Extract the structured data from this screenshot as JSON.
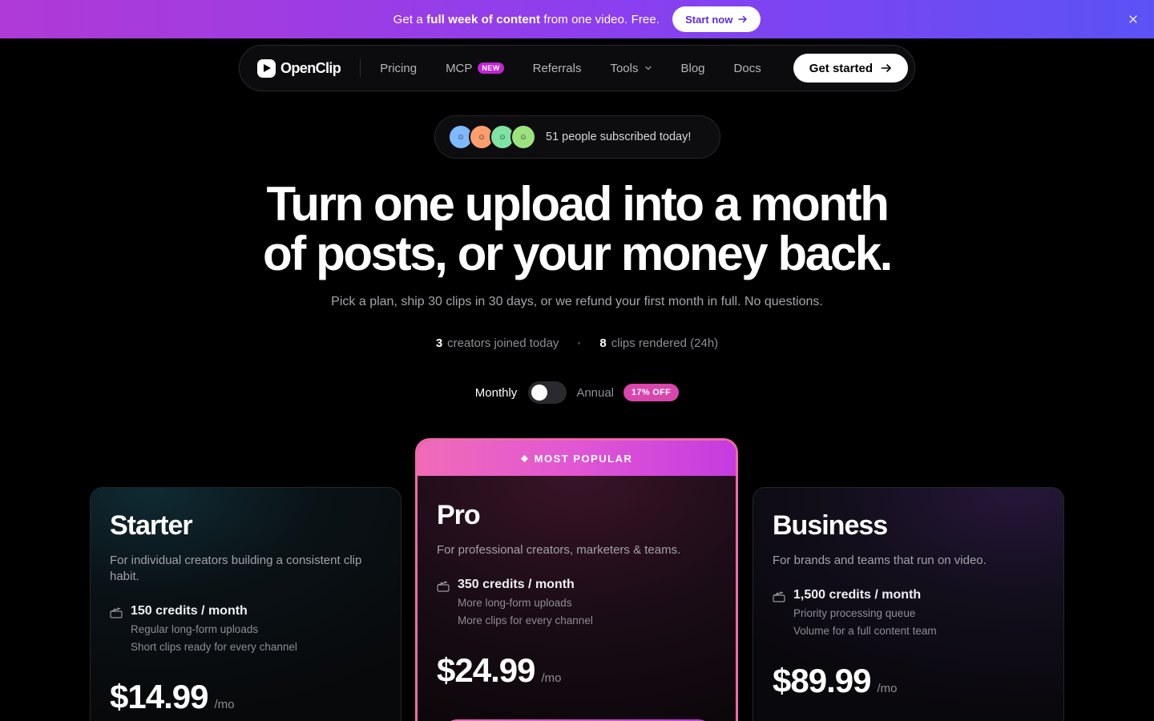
{
  "announcement": {
    "prefix": "Get a ",
    "bold": "full week of content",
    "suffix": " from one video. Free.",
    "button_label": "Start now",
    "button_icon": "arrow-right-icon",
    "close_icon": "close-icon"
  },
  "nav": {
    "logo_text": "OpenClip",
    "links": [
      {
        "label": "Pricing"
      },
      {
        "label": "MCP",
        "badge": "NEW"
      },
      {
        "label": "Referrals"
      },
      {
        "label": "Tools",
        "icon": "chevron-down-icon"
      },
      {
        "label": "Blog"
      },
      {
        "label": "Docs"
      }
    ],
    "cta_label": "Get started"
  },
  "social_proof": {
    "text": "51 people subscribed today!",
    "avatar_colors": [
      "#7fb9ff",
      "#ff9d6e",
      "#7fe3a2",
      "#9be37f"
    ]
  },
  "hero": {
    "title_line1": "Turn one upload into a month",
    "title_line2": "of posts, or your money back.",
    "subtitle": "Pick a plan, ship 30 clips in 30 days, or we refund your first month in full. No questions."
  },
  "stats": [
    {
      "value": "3",
      "label": "creators joined today"
    },
    {
      "value": "8",
      "label": "clips rendered (24h)"
    }
  ],
  "billing": {
    "monthly_label": "Monthly",
    "annual_label": "Annual",
    "discount_badge": "17% OFF",
    "selected": "Monthly"
  },
  "plans": {
    "starter": {
      "name": "Starter",
      "description": "For individual creators building a consistent clip habit.",
      "credits": "150 credits / month",
      "features": [
        "Regular long-form uploads",
        "Short clips ready for every channel"
      ],
      "price": "$14.99",
      "period": "/mo"
    },
    "pro": {
      "banner": "MOST POPULAR",
      "name": "Pro",
      "description": "For professional creators, marketers & teams.",
      "credits": "350 credits / month",
      "features": [
        "More long-form uploads",
        "More clips for every channel"
      ],
      "price": "$24.99",
      "period": "/mo"
    },
    "business": {
      "name": "Business",
      "description": "For brands and teams that run on video.",
      "credits": "1,500 credits / month",
      "features": [
        "Priority processing queue",
        "Volume for a full content team"
      ],
      "price": "$89.99",
      "period": "/mo"
    }
  },
  "colors": {
    "accent_pink": "#f06aaa",
    "accent_purple": "#8a3ff0",
    "background": "#000000"
  }
}
